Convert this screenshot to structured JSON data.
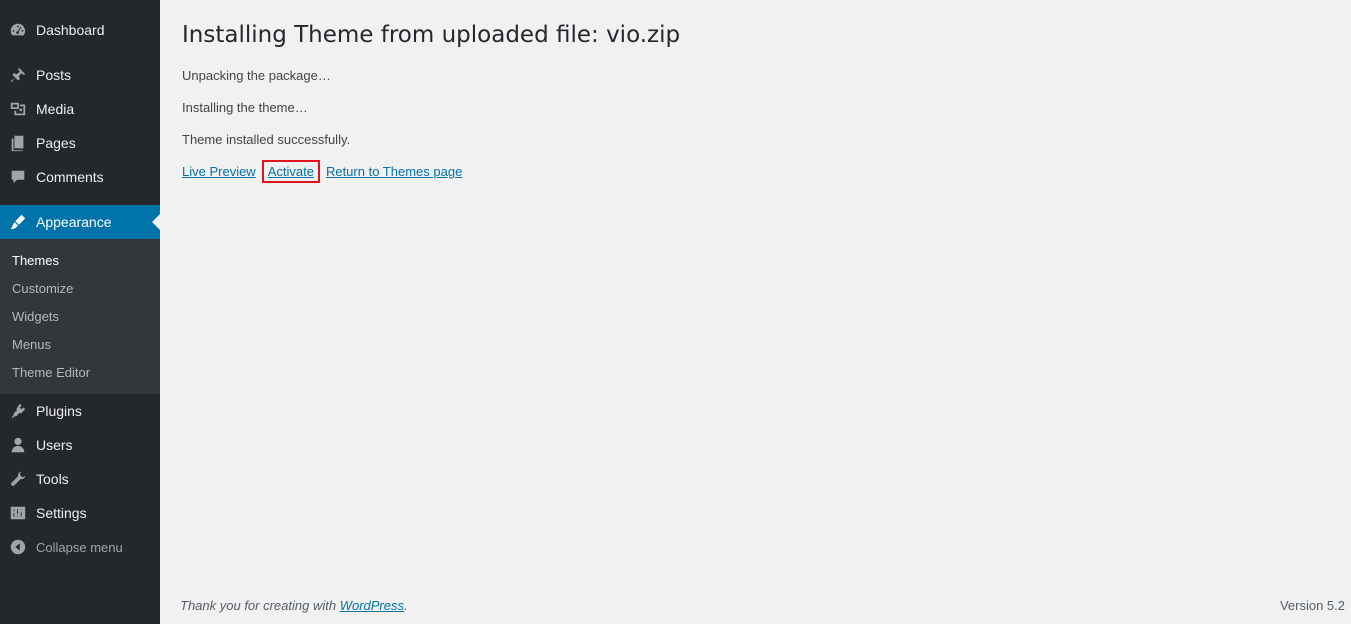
{
  "sidebar": {
    "items": [
      {
        "label": "Dashboard",
        "icon": "dashboard-icon"
      },
      {
        "label": "Posts",
        "icon": "pin-icon"
      },
      {
        "label": "Media",
        "icon": "media-icon"
      },
      {
        "label": "Pages",
        "icon": "pages-icon"
      },
      {
        "label": "Comments",
        "icon": "comment-icon"
      },
      {
        "label": "Appearance",
        "icon": "brush-icon",
        "current": true
      },
      {
        "label": "Plugins",
        "icon": "plug-icon"
      },
      {
        "label": "Users",
        "icon": "user-icon"
      },
      {
        "label": "Tools",
        "icon": "wrench-icon"
      },
      {
        "label": "Settings",
        "icon": "sliders-icon"
      }
    ],
    "submenu": [
      "Themes",
      "Customize",
      "Widgets",
      "Menus",
      "Theme Editor"
    ],
    "collapse_label": "Collapse menu"
  },
  "main": {
    "title": "Installing Theme from uploaded file: vio.zip",
    "messages": [
      "Unpacking the package…",
      "Installing the theme…",
      "Theme installed successfully."
    ],
    "actions": {
      "live_preview": "Live Preview",
      "activate": "Activate",
      "return": "Return to Themes page"
    }
  },
  "footer": {
    "thanks_prefix": "Thank you for creating with ",
    "thanks_link": "WordPress",
    "thanks_suffix": ".",
    "version": "Version 5.2"
  },
  "colors": {
    "sidebar_bg": "#23282d",
    "submenu_bg": "#32373c",
    "accent": "#0073aa",
    "highlight_box": "#e0141e"
  }
}
